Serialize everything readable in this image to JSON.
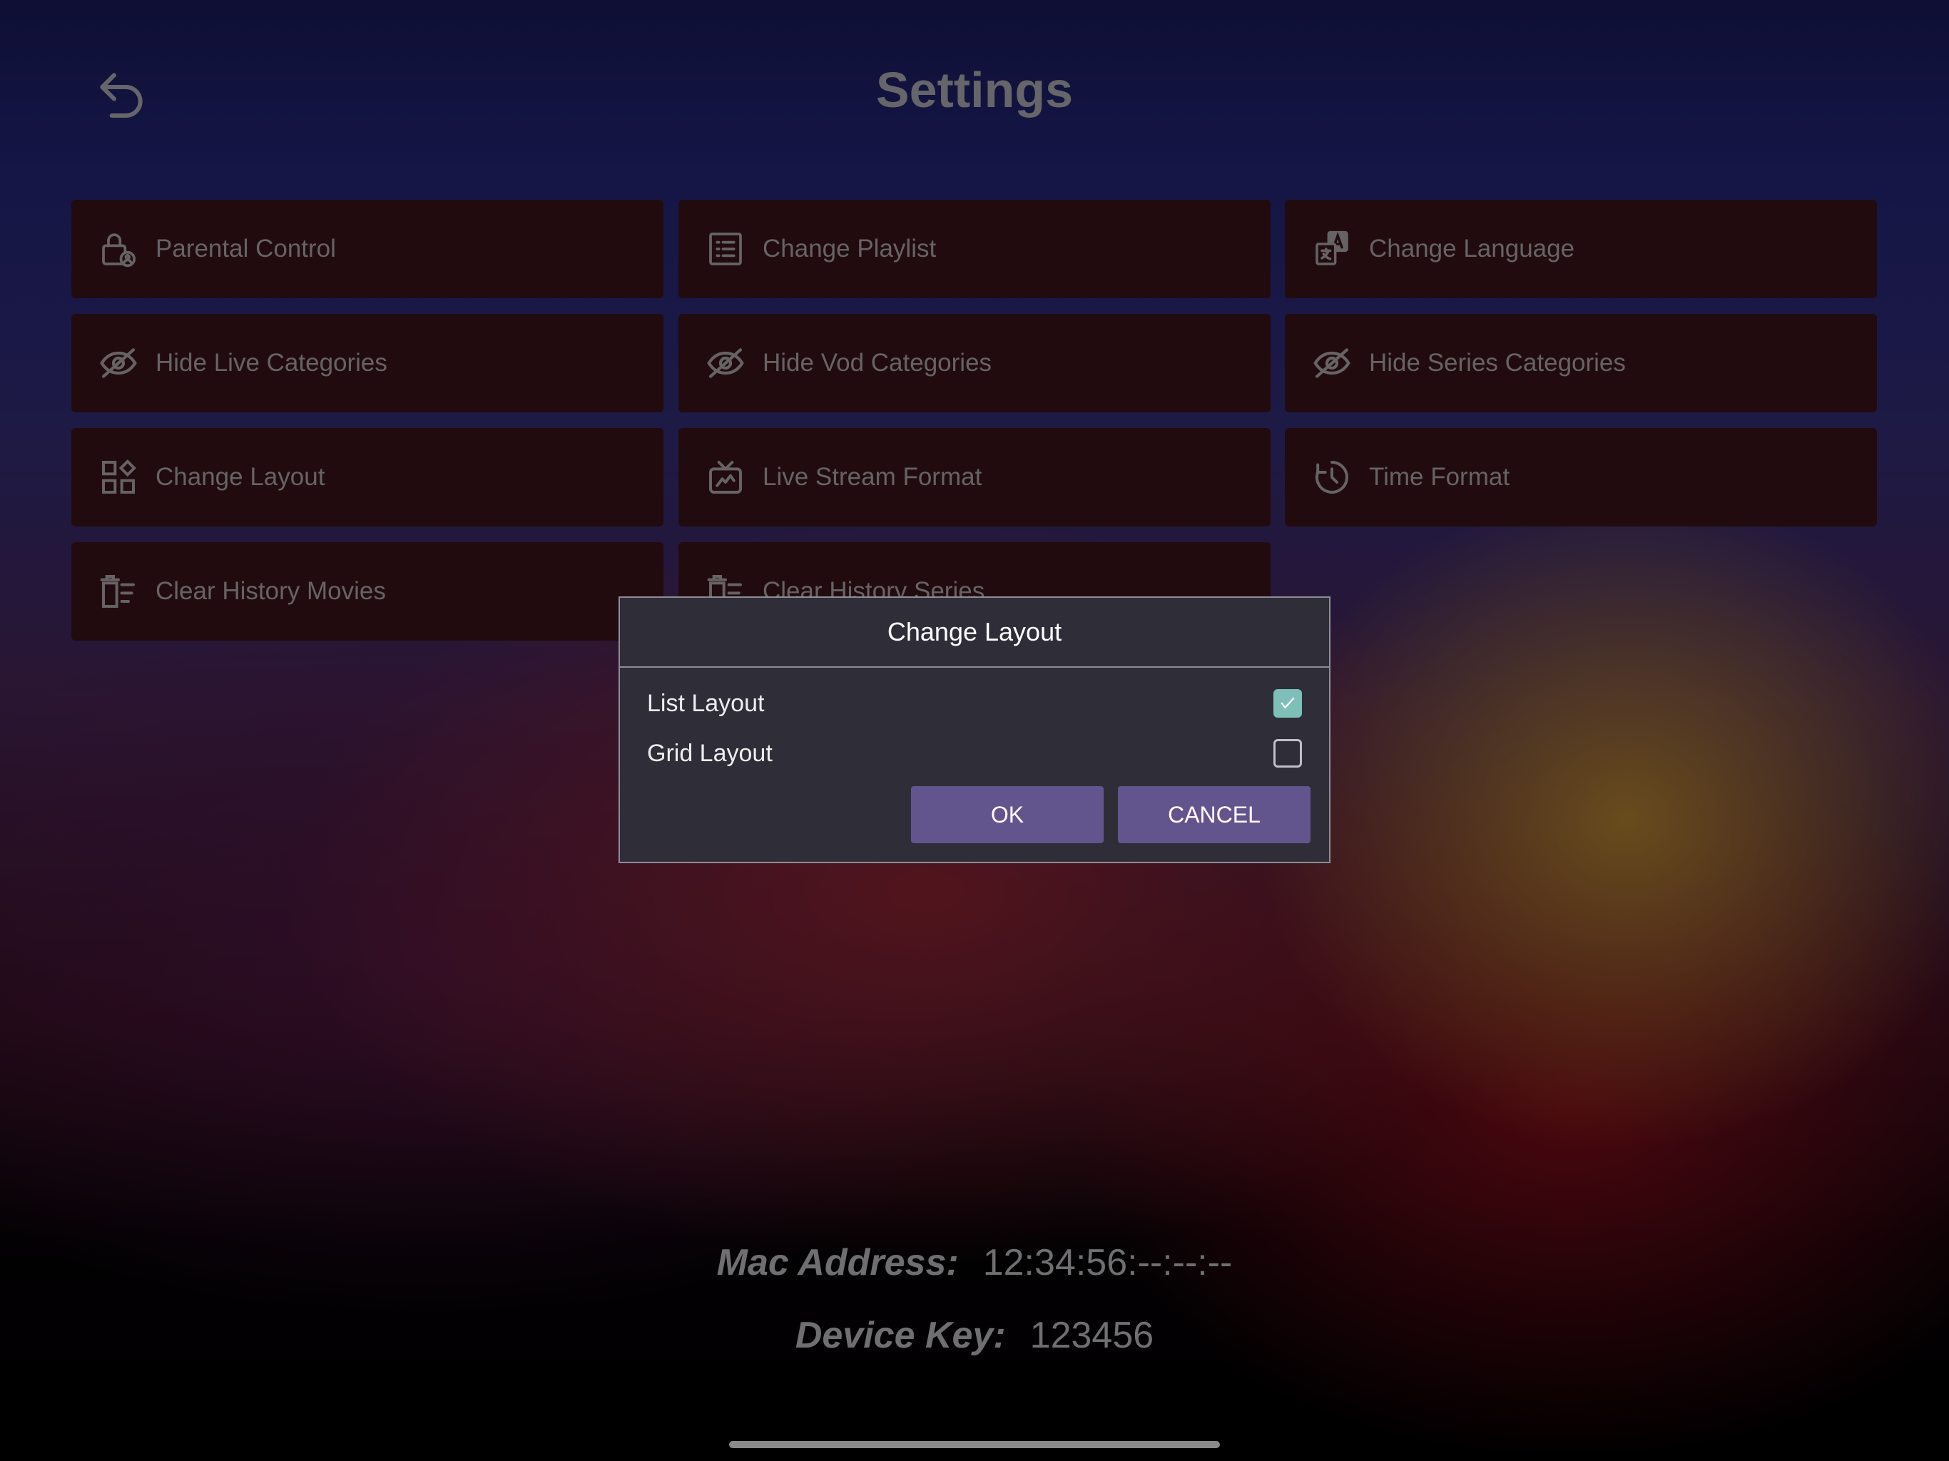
{
  "header": {
    "title": "Settings",
    "back_icon": "back-arrow-icon"
  },
  "tiles": [
    {
      "label": "Parental Control",
      "icon": "lock-icon"
    },
    {
      "label": "Change Playlist",
      "icon": "playlist-icon"
    },
    {
      "label": "Change Language",
      "icon": "language-icon"
    },
    {
      "label": "Hide Live Categories",
      "icon": "eye-off-icon"
    },
    {
      "label": "Hide Vod Categories",
      "icon": "eye-off-icon"
    },
    {
      "label": "Hide Series Categories",
      "icon": "eye-off-icon"
    },
    {
      "label": "Change Layout",
      "icon": "layout-icon"
    },
    {
      "label": "Live Stream Format",
      "icon": "tv-icon"
    },
    {
      "label": "Time Format",
      "icon": "clock-icon"
    },
    {
      "label": "Clear History Movies",
      "icon": "clear-list-icon"
    },
    {
      "label": "Clear History Series",
      "icon": "clear-list-icon"
    }
  ],
  "dialog": {
    "title": "Change Layout",
    "options": [
      {
        "label": "List Layout",
        "checked": true
      },
      {
        "label": "Grid Layout",
        "checked": false
      }
    ],
    "ok_label": "OK",
    "cancel_label": "CANCEL"
  },
  "device": {
    "mac_label": "Mac Address:",
    "mac_value": "12:34:56:--:--:--",
    "key_label": "Device Key:",
    "key_value": "123456"
  },
  "colors": {
    "tile_bg": "#2f1014",
    "dialog_bg": "#2e2d38",
    "button_bg": "#62558e",
    "checkbox_checked": "#7fbfb9"
  }
}
